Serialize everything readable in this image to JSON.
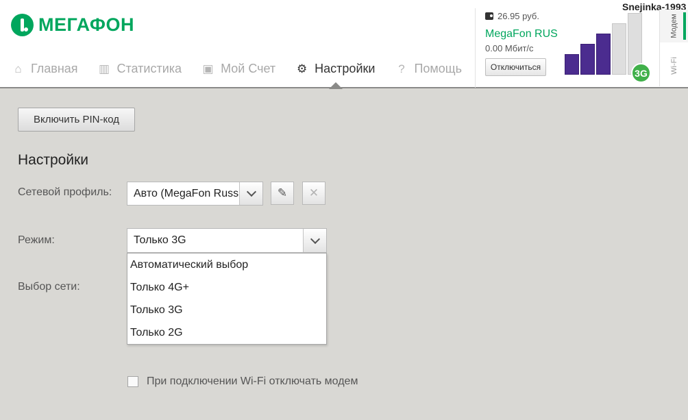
{
  "brand": {
    "name": "МЕГАФОН"
  },
  "nav": {
    "items": [
      {
        "label": "Главная",
        "icon": "home-icon"
      },
      {
        "label": "Статистика",
        "icon": "stats-icon"
      },
      {
        "label": "Мой Счет",
        "icon": "wallet-icon"
      },
      {
        "label": "Настройки",
        "icon": "gear-icon",
        "active": true
      },
      {
        "label": "Помощь",
        "icon": "help-icon"
      }
    ]
  },
  "status": {
    "balance": "26.95 руб.",
    "operator": "MegaFon RUS",
    "speed": "0.00 Мбит/с",
    "disconnect_label": "Отключиться",
    "network_type": "3G",
    "signal_level_of_5": 3
  },
  "user": {
    "name": "Snejinka-1993"
  },
  "side_tabs": {
    "modem": "Модем",
    "wifi": "Wi-Fi"
  },
  "page": {
    "pin_button": "Включить PIN-код",
    "title": "Настройки",
    "profile_label": "Сетевой профиль:",
    "profile_value": "Авто (MegaFon Russia)",
    "mode_label": "Режим:",
    "mode_value": "Только 3G",
    "mode_options": [
      "Автоматический выбор",
      "Только 4G+",
      "Только 3G",
      "Только 2G"
    ],
    "network_label": "Выбор сети:",
    "wifi_checkbox_label": "При подключении Wi-Fi отключать модем",
    "wifi_checkbox_checked": false
  },
  "colors": {
    "brand_green": "#00a65d",
    "signal_purple": "#4b2c8f",
    "badge_green": "#40b04a"
  }
}
